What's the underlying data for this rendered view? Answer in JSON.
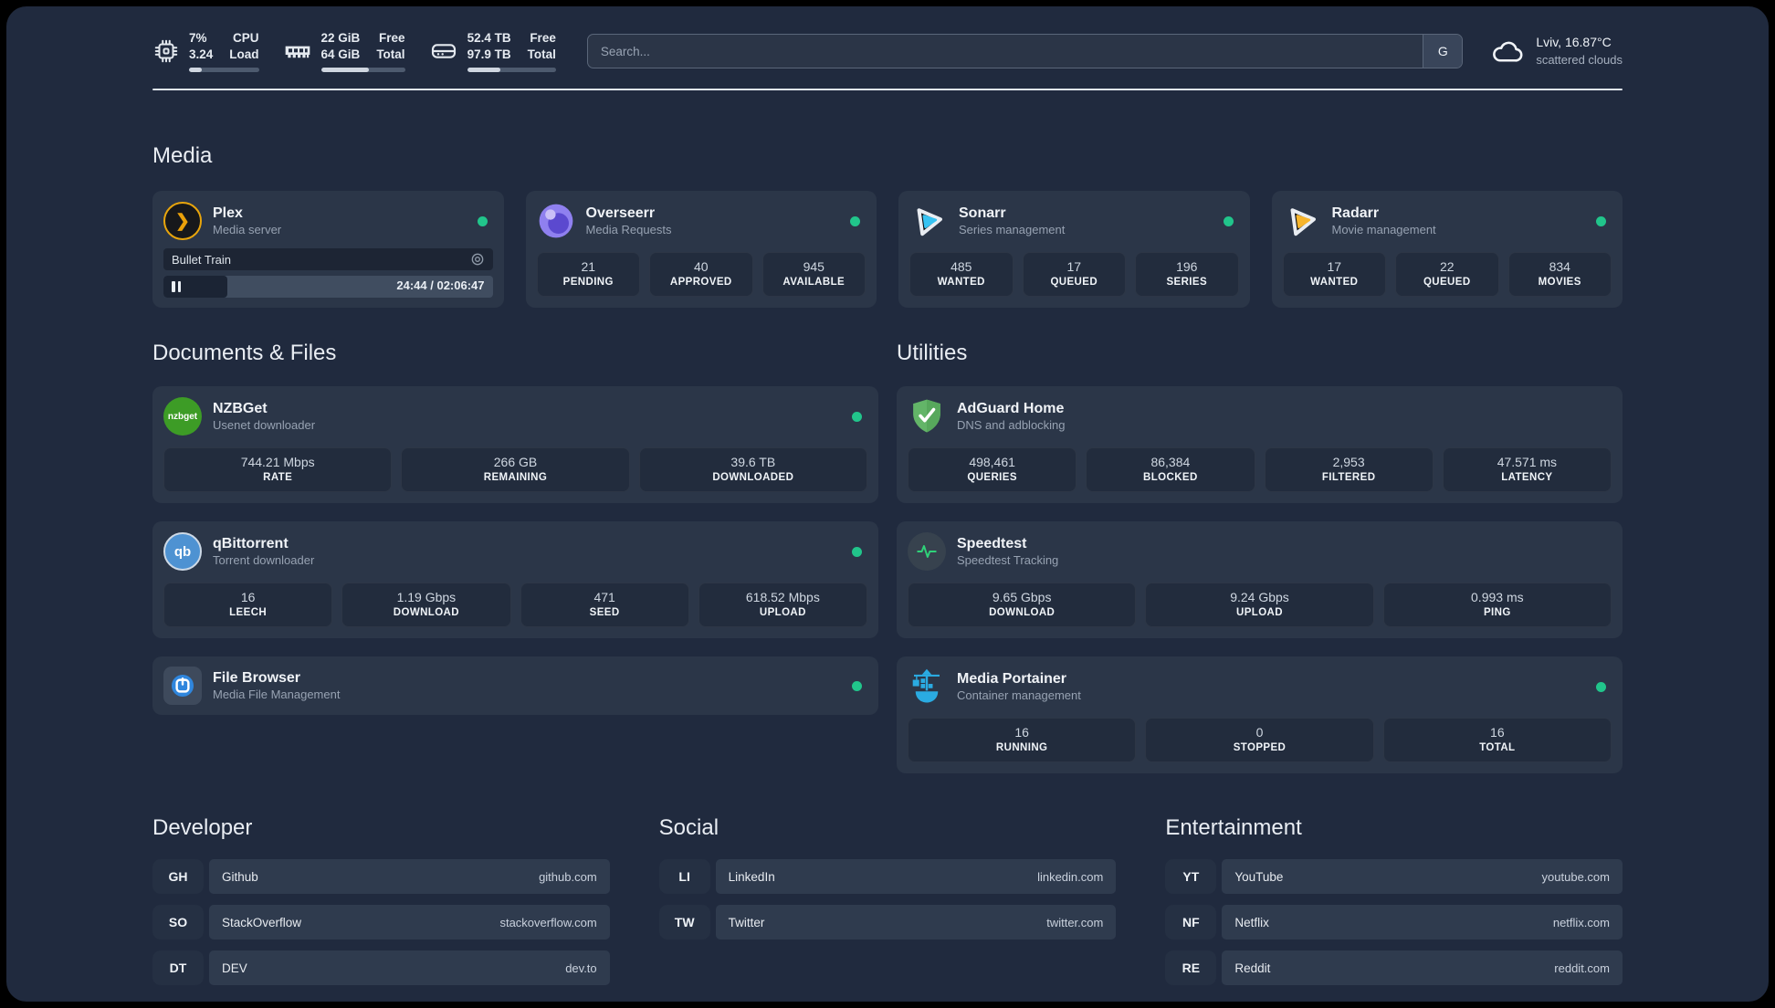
{
  "colors": {
    "panel_bg": "#202a3e",
    "card_bg": "#2b3648",
    "tile_bg": "#222c3d",
    "online_dot": "#21c58b"
  },
  "header": {
    "system_stats": [
      {
        "icon": "cpu-icon",
        "values": [
          "7%",
          "3.24"
        ],
        "labels": [
          "CPU",
          "Load"
        ],
        "progress_pct": "18%"
      },
      {
        "icon": "memory-icon",
        "values": [
          "22 GiB",
          "64 GiB"
        ],
        "labels": [
          "Free",
          "Total"
        ],
        "progress_pct": "57%"
      },
      {
        "icon": "disk-icon",
        "values": [
          "52.4 TB",
          "97.9 TB"
        ],
        "labels": [
          "Free",
          "Total"
        ],
        "progress_pct": "37%"
      }
    ],
    "search": {
      "placeholder": "Search...",
      "engine_badge": "G"
    },
    "weather": {
      "location": "Lviv, 16.87°C",
      "condition": "scattered clouds"
    }
  },
  "media_section": {
    "title": "Media",
    "apps": [
      {
        "name": "Plex",
        "description": "Media server",
        "online": true,
        "player": {
          "now_playing": "Bullet Train",
          "time_display": "24:44 / 02:06:47",
          "progress_pct": "19.5%"
        }
      },
      {
        "name": "Overseerr",
        "description": "Media Requests",
        "online": true,
        "stats": [
          {
            "value": "21",
            "label": "PENDING"
          },
          {
            "value": "40",
            "label": "APPROVED"
          },
          {
            "value": "945",
            "label": "AVAILABLE"
          }
        ]
      },
      {
        "name": "Sonarr",
        "description": "Series management",
        "online": true,
        "stats": [
          {
            "value": "485",
            "label": "WANTED"
          },
          {
            "value": "17",
            "label": "QUEUED"
          },
          {
            "value": "196",
            "label": "SERIES"
          }
        ]
      },
      {
        "name": "Radarr",
        "description": "Movie management",
        "online": true,
        "stats": [
          {
            "value": "17",
            "label": "WANTED"
          },
          {
            "value": "22",
            "label": "QUEUED"
          },
          {
            "value": "834",
            "label": "MOVIES"
          }
        ]
      }
    ]
  },
  "documents_section": {
    "title": "Documents & Files",
    "apps": [
      {
        "name": "NZBGet",
        "description": "Usenet downloader",
        "online": true,
        "icon_text": "nzbget",
        "stats": [
          {
            "value": "744.21 Mbps",
            "label": "RATE"
          },
          {
            "value": "266 GB",
            "label": "REMAINING"
          },
          {
            "value": "39.6 TB",
            "label": "DOWNLOADED"
          }
        ]
      },
      {
        "name": "qBittorrent",
        "description": "Torrent downloader",
        "online": true,
        "icon_text": "qb",
        "stats": [
          {
            "value": "16",
            "label": "LEECH"
          },
          {
            "value": "1.19 Gbps",
            "label": "DOWNLOAD"
          },
          {
            "value": "471",
            "label": "SEED"
          },
          {
            "value": "618.52 Mbps",
            "label": "UPLOAD"
          }
        ]
      },
      {
        "name": "File Browser",
        "description": "Media File Management",
        "online": true,
        "stats": []
      }
    ]
  },
  "utilities_section": {
    "title": "Utilities",
    "apps": [
      {
        "name": "AdGuard Home",
        "description": "DNS and adblocking",
        "online": false,
        "stats": [
          {
            "value": "498,461",
            "label": "QUERIES"
          },
          {
            "value": "86,384",
            "label": "BLOCKED"
          },
          {
            "value": "2,953",
            "label": "FILTERED"
          },
          {
            "value": "47.571 ms",
            "label": "LATENCY"
          }
        ]
      },
      {
        "name": "Speedtest",
        "description": "Speedtest Tracking",
        "online": false,
        "stats": [
          {
            "value": "9.65 Gbps",
            "label": "DOWNLOAD"
          },
          {
            "value": "9.24 Gbps",
            "label": "UPLOAD"
          },
          {
            "value": "0.993 ms",
            "label": "PING"
          }
        ]
      },
      {
        "name": "Media Portainer",
        "description": "Container management",
        "online": true,
        "stats": [
          {
            "value": "16",
            "label": "RUNNING"
          },
          {
            "value": "0",
            "label": "STOPPED"
          },
          {
            "value": "16",
            "label": "TOTAL"
          }
        ]
      }
    ]
  },
  "link_sections": [
    {
      "title": "Developer",
      "links": [
        {
          "tag": "GH",
          "name": "Github",
          "url": "github.com"
        },
        {
          "tag": "SO",
          "name": "StackOverflow",
          "url": "stackoverflow.com"
        },
        {
          "tag": "DT",
          "name": "DEV",
          "url": "dev.to"
        }
      ]
    },
    {
      "title": "Social",
      "links": [
        {
          "tag": "LI",
          "name": "LinkedIn",
          "url": "linkedin.com"
        },
        {
          "tag": "TW",
          "name": "Twitter",
          "url": "twitter.com"
        }
      ]
    },
    {
      "title": "Entertainment",
      "links": [
        {
          "tag": "YT",
          "name": "YouTube",
          "url": "youtube.com"
        },
        {
          "tag": "NF",
          "name": "Netflix",
          "url": "netflix.com"
        },
        {
          "tag": "RE",
          "name": "Reddit",
          "url": "reddit.com"
        }
      ]
    }
  ]
}
